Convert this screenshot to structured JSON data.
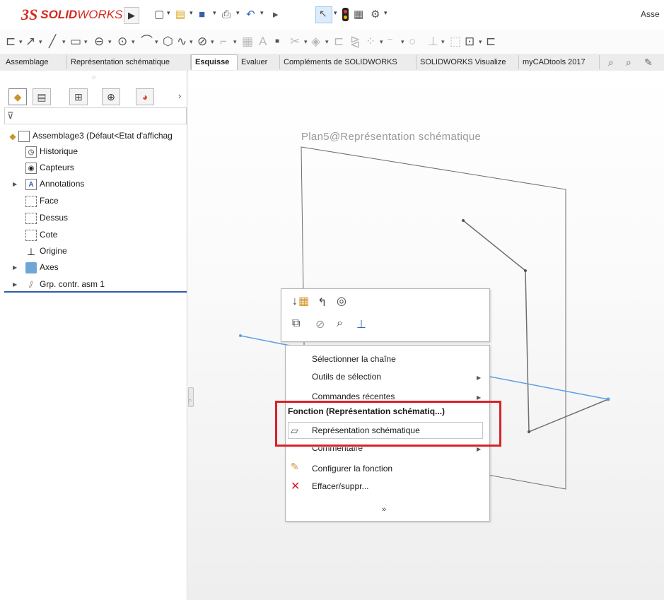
{
  "app": {
    "logo_mark": "3S",
    "logo_text_bold": "SOLID",
    "logo_text_light": "WORKS",
    "window_title": "Asse"
  },
  "tabs": [
    {
      "label": "Assemblage"
    },
    {
      "label": "Représentation schématique"
    },
    {
      "label": "Esquisse"
    },
    {
      "label": "Evaluer"
    },
    {
      "label": "Compléments de SOLIDWORKS"
    },
    {
      "label": "SOLIDWORKS Visualize"
    },
    {
      "label": "myCADtools 2017"
    }
  ],
  "active_tab": "Esquisse",
  "tree": {
    "root": "Assemblage3  (Défaut<Etat d'affichag",
    "items": [
      {
        "label": "Historique",
        "icon": "history-icon"
      },
      {
        "label": "Capteurs",
        "icon": "sensor-icon"
      },
      {
        "label": "Annotations",
        "icon": "annotations-icon"
      },
      {
        "label": "Face",
        "icon": "plane-icon"
      },
      {
        "label": "Dessus",
        "icon": "plane-icon"
      },
      {
        "label": "Cote",
        "icon": "plane-icon"
      },
      {
        "label": "Origine",
        "icon": "origin-icon"
      },
      {
        "label": "Axes",
        "icon": "folder-icon"
      },
      {
        "label": "Grp. contr. asm 1",
        "icon": "mate-group-icon"
      }
    ]
  },
  "viewport": {
    "plane_label": "Plan5@Représentation schématique"
  },
  "menu": {
    "items": [
      {
        "label": "Sélectionner la chaîne"
      },
      {
        "label": "Outils de sélection"
      },
      {
        "label": "Commandes récentes"
      }
    ],
    "section_header": "Fonction (Représentation schématiq...)",
    "highlighted": "Représentation schématique",
    "comment": "Commentaire",
    "configure": "Configurer la fonction",
    "delete": "Effacer/suppr...",
    "more": "»"
  },
  "colors": {
    "accent_red": "#d7222a",
    "sketch_blue": "#5aa0e6",
    "sketch_gray": "#6e6e6e",
    "brand_red": "#d52b1e"
  }
}
